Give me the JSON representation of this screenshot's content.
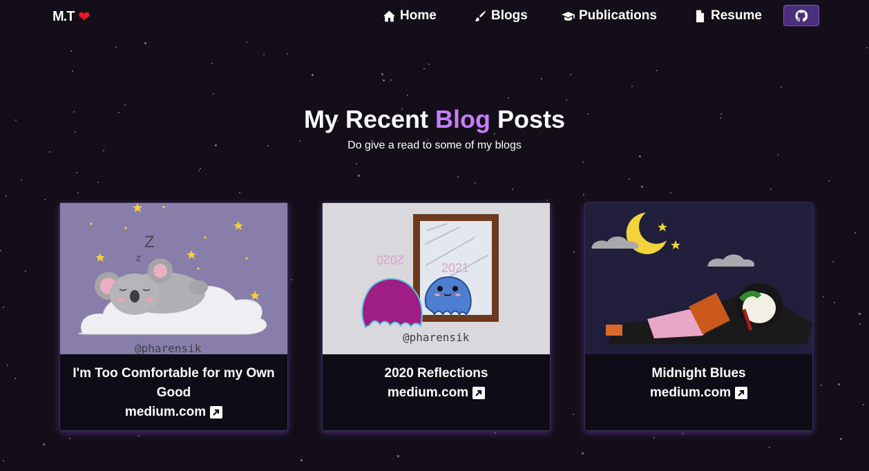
{
  "nav": {
    "brand": "M.T",
    "brand_icon": "heart-icon",
    "links": [
      {
        "label": "Home",
        "icon": "home-icon"
      },
      {
        "label": "Blogs",
        "icon": "brush-icon"
      },
      {
        "label": "Publications",
        "icon": "graduation-cap-icon"
      },
      {
        "label": "Resume",
        "icon": "file-icon"
      }
    ],
    "github_icon": "github-icon"
  },
  "page": {
    "title_prefix": "My Recent",
    "title_accent": "Blog",
    "title_suffix": "Posts",
    "subtitle": "Do give a read to some of my blogs"
  },
  "posts": [
    {
      "title": "I'm Too Comfortable for my Own Good",
      "link": "medium.com",
      "image_caption": "@pharensik"
    },
    {
      "title": "2020 Reflections",
      "link": "medium.com",
      "image_caption": "@pharensik",
      "image_labels": [
        "2020",
        "2021"
      ]
    },
    {
      "title": "Midnight Blues",
      "link": "medium.com"
    }
  ],
  "colors": {
    "background": "#120f19",
    "accent": "#c77dff",
    "github_button": "#4a2f7a",
    "heart": "#e01a2b"
  }
}
